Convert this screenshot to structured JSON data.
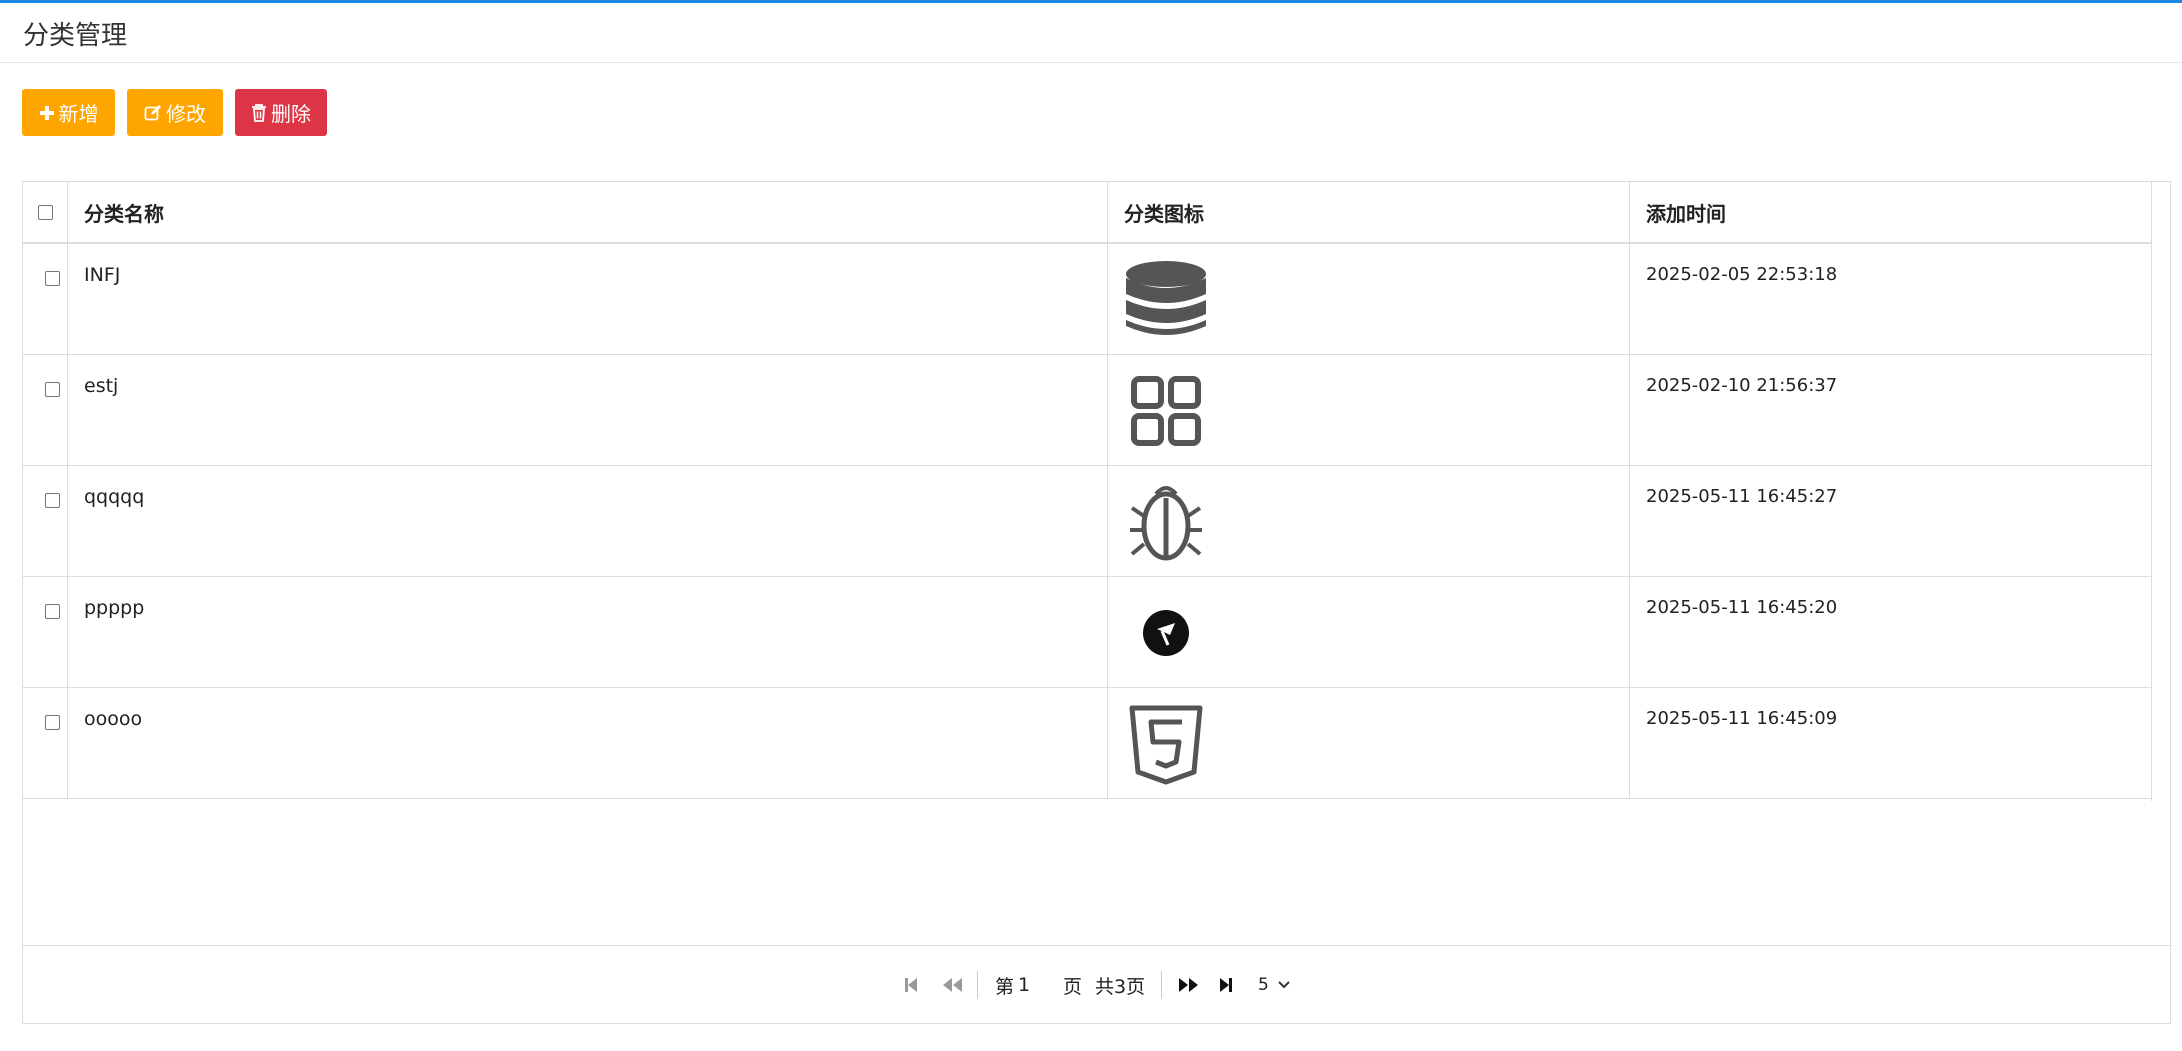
{
  "page": {
    "title": "分类管理"
  },
  "toolbar": {
    "add_label": "新增",
    "edit_label": "修改",
    "delete_label": "删除"
  },
  "colors": {
    "accent": "#1e88e5",
    "warning": "#ffa500",
    "danger": "#dc3545"
  },
  "table": {
    "headers": {
      "name": "分类名称",
      "icon": "分类图标",
      "time": "添加时间"
    },
    "rows": [
      {
        "name": "INFJ",
        "icon": "database-icon",
        "time": "2025-02-05 22:53:18"
      },
      {
        "name": "estj",
        "icon": "grid-apps-icon",
        "time": "2025-02-10 21:56:37"
      },
      {
        "name": "qqqqq",
        "icon": "bug-icon",
        "time": "2025-05-11 16:45:27"
      },
      {
        "name": "ppppp",
        "icon": "flag-circle-icon",
        "time": "2025-05-11 16:45:20"
      },
      {
        "name": "ooooo",
        "icon": "html5-icon",
        "time": "2025-05-11 16:45:09"
      }
    ]
  },
  "pager": {
    "page_prefix": "第",
    "current_page": "1",
    "page_suffix": "页",
    "total_text": "共3页",
    "page_size": "5"
  }
}
